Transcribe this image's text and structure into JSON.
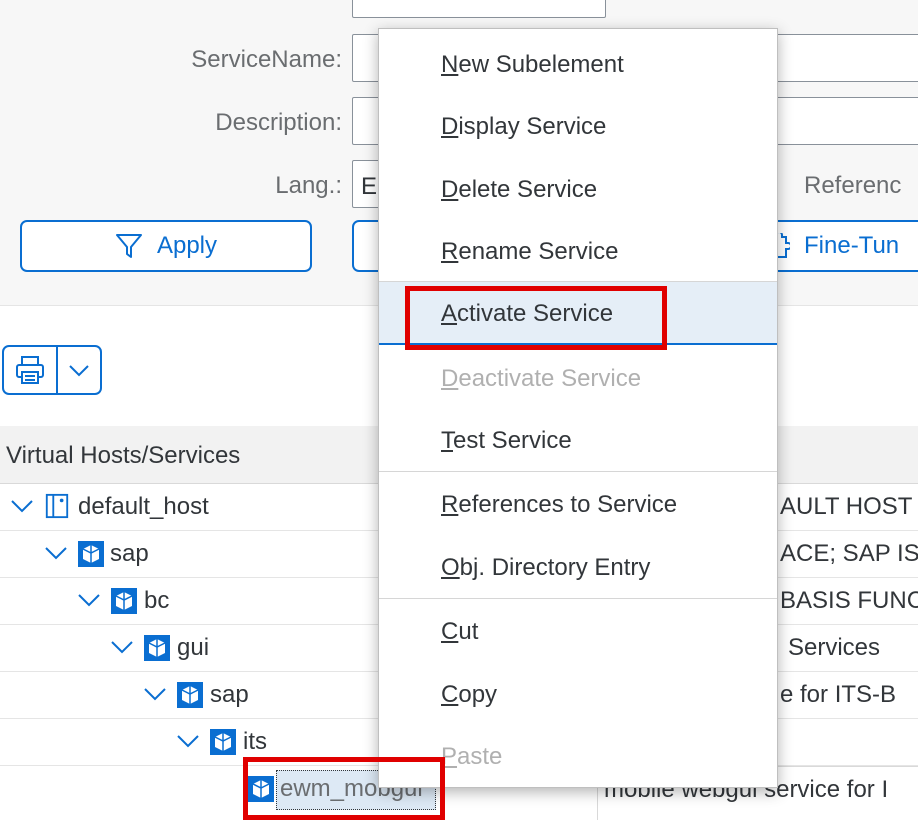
{
  "filter": {
    "service_name_label": "ServiceName:",
    "description_label": "Description:",
    "lang_label": "Lang.:",
    "lang_value": "E",
    "reference_label": "Referenc",
    "apply_label": "Apply",
    "fine_tune_label": "Fine-Tun"
  },
  "tree": {
    "header": "Virtual Hosts/Services",
    "rows": [
      {
        "label": "default_host",
        "desc": "AULT HOST"
      },
      {
        "label": "sap",
        "desc": "ACE; SAP IS"
      },
      {
        "label": "bc",
        "desc": "BASIS FUNC"
      },
      {
        "label": "gui",
        "desc": "Services"
      },
      {
        "label": "sap",
        "desc": "e for ITS-B"
      },
      {
        "label": "its",
        "desc": ""
      },
      {
        "label": "ewm_mobgui",
        "desc": "mobile webgui service for I"
      }
    ]
  },
  "menu": {
    "items": [
      {
        "first": "N",
        "rest": "ew Subelement"
      },
      {
        "first": "D",
        "rest": "isplay Service"
      },
      {
        "first": "D",
        "rest": "elete Service"
      },
      {
        "first": "R",
        "rest": "ename Service"
      },
      {
        "first": "A",
        "rest": "ctivate Service"
      },
      {
        "first": "D",
        "rest": "eactivate Service"
      },
      {
        "first": "T",
        "rest": "est Service"
      },
      {
        "first": "R",
        "rest": "eferences to Service"
      },
      {
        "first": "O",
        "rest": "bj. Directory Entry"
      },
      {
        "first": "C",
        "rest": "ut"
      },
      {
        "first": "C",
        "rest": "opy"
      },
      {
        "first": "P",
        "rest": "aste"
      }
    ]
  },
  "colors": {
    "accent": "#0a6ed1",
    "highlight_border": "#e00000",
    "menu_hover_bg": "#e5eef7"
  }
}
